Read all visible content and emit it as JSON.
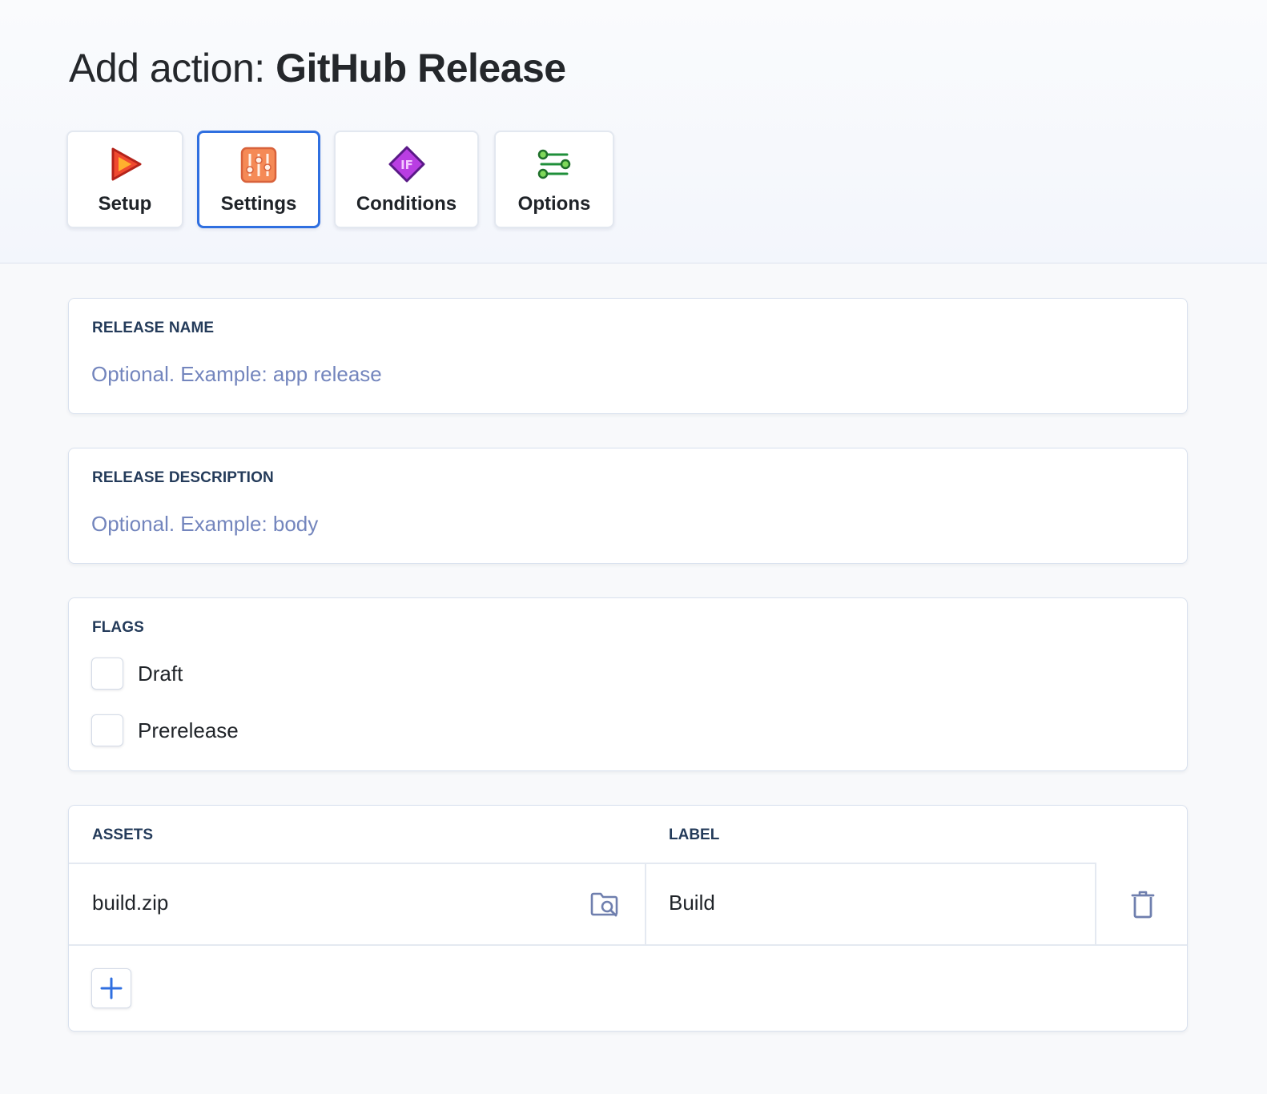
{
  "header": {
    "title_prefix": "Add action: ",
    "title_name": "GitHub Release"
  },
  "tabs": [
    {
      "label": "Setup",
      "icon": "play-icon",
      "active": false
    },
    {
      "label": "Settings",
      "icon": "sliders-icon",
      "active": true
    },
    {
      "label": "Conditions",
      "icon": "if-diamond-icon",
      "active": false
    },
    {
      "label": "Options",
      "icon": "options-icon",
      "active": false
    }
  ],
  "release_name": {
    "label": "RELEASE NAME",
    "value": "",
    "placeholder": "Optional. Example: app release"
  },
  "release_description": {
    "label": "RELEASE DESCRIPTION",
    "value": "",
    "placeholder": "Optional. Example: body"
  },
  "flags": {
    "label": "FLAGS",
    "items": [
      {
        "label": "Draft",
        "checked": false
      },
      {
        "label": "Prerelease",
        "checked": false
      }
    ]
  },
  "assets": {
    "columns": [
      "ASSETS",
      "LABEL"
    ],
    "rows": [
      {
        "asset": "build.zip",
        "label": "Build"
      }
    ],
    "icons": {
      "browse": "folder-search-icon",
      "delete": "trash-icon",
      "add": "plus-icon"
    }
  },
  "colors": {
    "accent": "#2f6fe0",
    "placeholder": "#7385bd",
    "label": "#243b5a",
    "icon_muted": "#6f7fae"
  }
}
